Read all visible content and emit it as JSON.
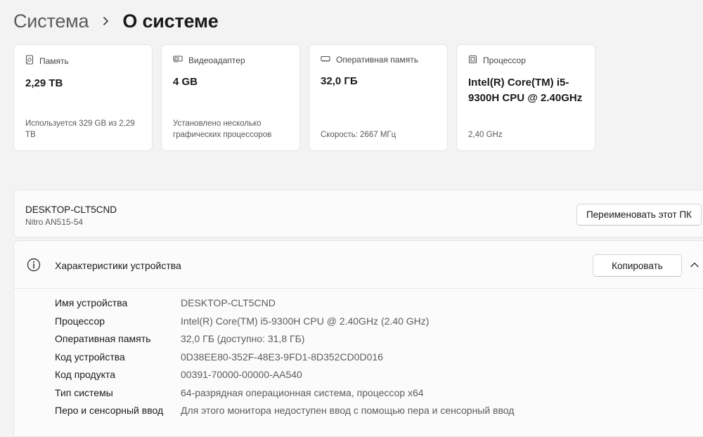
{
  "breadcrumb": {
    "parent": "Система",
    "current": "О системе"
  },
  "cards": [
    {
      "icon": "storage-icon",
      "title": "Память",
      "value": "2,29 TB",
      "sub": "Используется 329 GB из 2,29 TB"
    },
    {
      "icon": "display-adapter-icon",
      "title": "Видеоадаптер",
      "value": "4 GB",
      "sub": "Установлено несколько графических процессоров"
    },
    {
      "icon": "ram-icon",
      "title": "Оперативная память",
      "value": "32,0 ГБ",
      "sub": "Скорость: 2667 МГц"
    },
    {
      "icon": "cpu-icon",
      "title": "Процессор",
      "value": "Intel(R) Core(TM) i5-9300H CPU @ 2.40GHz",
      "sub": "2,40 GHz"
    }
  ],
  "device": {
    "name": "DESKTOP-CLT5CND",
    "model": "Nitro AN515-54",
    "rename_label": "Переименовать этот ПК"
  },
  "specs": {
    "title": "Характеристики устройства",
    "copy_label": "Копировать",
    "rows": [
      {
        "label": "Имя устройства",
        "value": "DESKTOP-CLT5CND"
      },
      {
        "label": "Процессор",
        "value": "Intel(R) Core(TM) i5-9300H CPU @ 2.40GHz (2.40 GHz)"
      },
      {
        "label": "Оперативная память",
        "value": "32,0 ГБ (доступно: 31,8 ГБ)"
      },
      {
        "label": "Код устройства",
        "value": "0D38EE80-352F-48E3-9FD1-8D352CD0D016"
      },
      {
        "label": "Код продукта",
        "value": "00391-70000-00000-AA540"
      },
      {
        "label": "Тип системы",
        "value": "64-разрядная операционная система, процессор x64"
      },
      {
        "label": "Перо и сенсорный ввод",
        "value": "Для этого монитора недоступен ввод с помощью пера и сенсорный ввод"
      }
    ]
  }
}
